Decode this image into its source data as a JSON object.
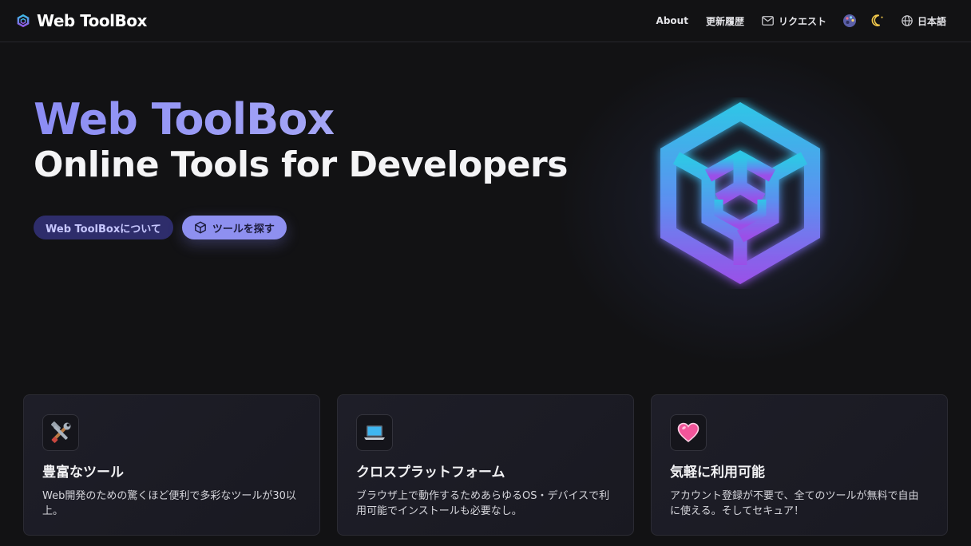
{
  "nav": {
    "brand": "Web ToolBox",
    "about": "About",
    "changelog": "更新履歴",
    "request": "リクエスト",
    "language": "日本語"
  },
  "hero": {
    "title": "Web ToolBox",
    "subtitle": "Online Tools for Developers",
    "about_button": "Web ToolBoxについて",
    "tools_button": "ツールを探す"
  },
  "features": [
    {
      "icon": "tools-emoji-icon",
      "title": "豊富なツール",
      "desc": "Web開発のための驚くほど便利で多彩なツールが30以上。"
    },
    {
      "icon": "laptop-emoji-icon",
      "title": "クロスプラットフォーム",
      "desc": "ブラウザ上で動作するためあらゆるOS・デバイスで利用可能でインストールも必要なし。"
    },
    {
      "icon": "heart-emoji-icon",
      "title": "気軽に利用可能",
      "desc": "アカウント登録が不要で、全てのツールが無料で自由に使える。そしてセキュア！"
    }
  ],
  "colors": {
    "background": "#121214",
    "accent": "#8e90f0",
    "title_gradient_start": "#8b8cf4",
    "logo_gradient_top": "#2ec7e6",
    "logo_gradient_bottom": "#9b4fe8"
  }
}
